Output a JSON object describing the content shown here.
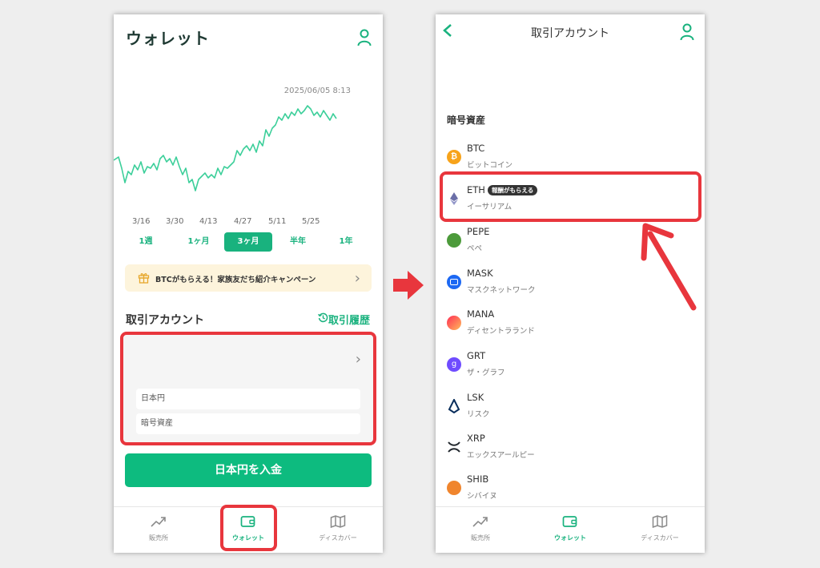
{
  "left_screen": {
    "title": "ウォレット",
    "chart_timestamp": "2025/06/05 8:13",
    "x_ticks": [
      "3/16",
      "3/30",
      "4/13",
      "4/27",
      "5/11",
      "5/25"
    ],
    "periods": [
      "1週",
      "1ヶ月",
      "3ヶ月",
      "半年",
      "1年"
    ],
    "active_period": "3ヶ月",
    "campaign_text": "BTCがもらえる！家族友だち紹介キャンペーン",
    "section_title": "取引アカウント",
    "history_label": "取引履歴",
    "account_rows": [
      "日本円",
      "暗号資産"
    ],
    "deposit_button": "日本円を入金"
  },
  "right_screen": {
    "title": "取引アカウント",
    "section_title": "暗号資産",
    "coins": [
      {
        "symbol": "BTC",
        "name": "ビットコイン",
        "color": "#f7a31a"
      },
      {
        "symbol": "ETH",
        "name": "イーサリアム",
        "badge": "報酬がもらえる",
        "color": "#6b6fa8"
      },
      {
        "symbol": "PEPE",
        "name": "ペペ",
        "color": "#4c9a3a"
      },
      {
        "symbol": "MASK",
        "name": "マスクネットワーク",
        "color": "#1c68f3"
      },
      {
        "symbol": "MANA",
        "name": "ディセントラランド",
        "color": "#ff5a4e"
      },
      {
        "symbol": "GRT",
        "name": "ザ・グラフ",
        "color": "#6f4cff"
      },
      {
        "symbol": "LSK",
        "name": "リスク",
        "color": "#0a2e5c"
      },
      {
        "symbol": "XRP",
        "name": "エックスアールピー",
        "color": "#23292f"
      },
      {
        "symbol": "SHIB",
        "name": "シバイヌ",
        "color": "#f0852d"
      }
    ]
  },
  "bottom_nav": [
    "販売所",
    "ウォレット",
    "ディスカバー"
  ],
  "active_nav": "ウォレット",
  "colors": {
    "accent": "#19b27e",
    "highlight": "#e8363d",
    "campaign_bg": "#fdf4dc"
  }
}
